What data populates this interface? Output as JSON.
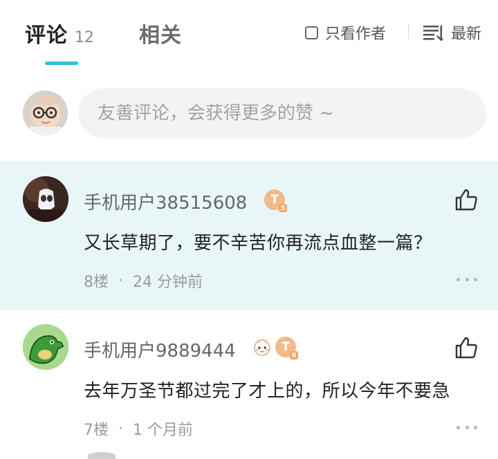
{
  "tabs": {
    "comments_label": "评论",
    "comments_count": "12",
    "related_label": "相关",
    "author_only_label": "只看作者",
    "sort_label": "最新"
  },
  "input": {
    "placeholder": "友善评论，会获得更多的赞 ~"
  },
  "colors": {
    "accent": "#2bc1d8",
    "highlight_bg": "#e9f6f8",
    "level_badge": "#f2b98a"
  },
  "comments": [
    {
      "username": "手机用户38515608",
      "level": "5",
      "text": "又长草期了，要不辛苦你再流点血整一篇？",
      "floor": "8楼",
      "time": "24 分钟前",
      "avatar_icon": "dark-skull-avatar"
    },
    {
      "username": "手机用户9889444",
      "level": "6",
      "text": "去年万圣节都过完了才上的，所以今年不要急",
      "floor": "7楼",
      "time": "1 个月前",
      "avatar_icon": "green-dinosaur-avatar"
    }
  ]
}
